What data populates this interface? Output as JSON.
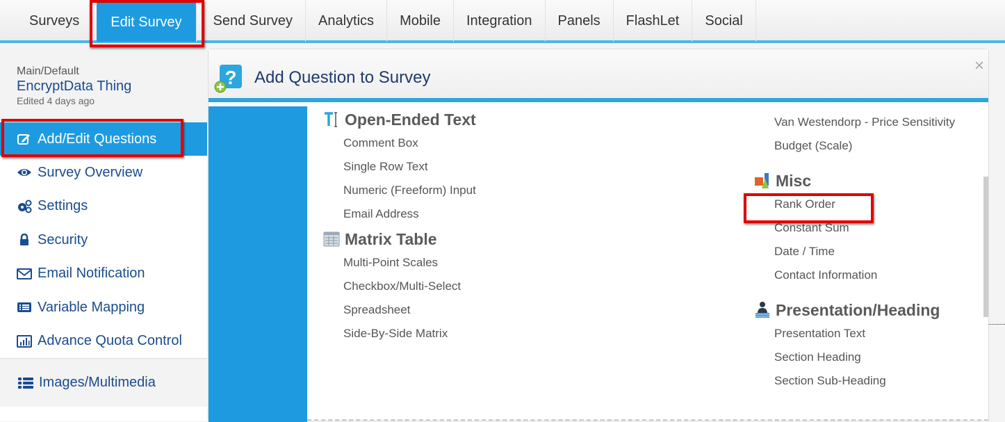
{
  "topnav": {
    "tabs": [
      {
        "label": "Surveys",
        "active": false
      },
      {
        "label": "Edit Survey",
        "active": true
      },
      {
        "label": "Send Survey",
        "active": false
      },
      {
        "label": "Analytics",
        "active": false
      },
      {
        "label": "Mobile",
        "active": false
      },
      {
        "label": "Integration",
        "active": false
      },
      {
        "label": "Panels",
        "active": false
      },
      {
        "label": "FlashLet",
        "active": false
      },
      {
        "label": "Social",
        "active": false
      }
    ]
  },
  "sidebar": {
    "breadcrumb": "Main/Default",
    "survey_name": "EncryptData Thing",
    "edited": "Edited 4 days ago",
    "items": [
      {
        "label": "Add/Edit Questions",
        "icon": "edit-icon",
        "active": true
      },
      {
        "label": "Survey Overview",
        "icon": "eye-icon"
      },
      {
        "label": "Settings",
        "icon": "gears-icon"
      },
      {
        "label": "Security",
        "icon": "lock-icon"
      },
      {
        "label": "Email Notification",
        "icon": "envelope-icon"
      },
      {
        "label": "Variable Mapping",
        "icon": "list-icon"
      },
      {
        "label": "Advance Quota Control",
        "icon": "bar-chart-icon"
      },
      {
        "label": "Images/Multimedia",
        "icon": "list-bullets-icon"
      }
    ]
  },
  "modal": {
    "title": "Add Question to Survey",
    "close": "×",
    "sections_left": [
      {
        "title": "Open-Ended Text",
        "icon": "text-cursor-icon",
        "items": [
          "Comment Box",
          "Single Row Text",
          "Numeric (Freeform) Input",
          "Email Address"
        ]
      },
      {
        "title": "Matrix Table",
        "icon": "table-icon",
        "items": [
          "Multi-Point Scales",
          "Checkbox/Multi-Select",
          "Spreadsheet",
          "Side-By-Side Matrix"
        ]
      }
    ],
    "sections_right_top": {
      "items": [
        "Van Westendorp - Price Sensitivity",
        "Budget (Scale)"
      ]
    },
    "sections_right": [
      {
        "title": "Misc",
        "icon": "shapes-icon",
        "items": [
          "Rank Order",
          "Constant Sum",
          "Date / Time",
          "Contact Information"
        ]
      },
      {
        "title": "Presentation/Heading",
        "icon": "presenter-icon",
        "items": [
          "Presentation Text",
          "Section Heading",
          "Section Sub-Heading"
        ]
      }
    ]
  },
  "colors": {
    "accent": "#1e9be0",
    "highlight": "#e00000",
    "nav_text": "#1a4c8f"
  }
}
